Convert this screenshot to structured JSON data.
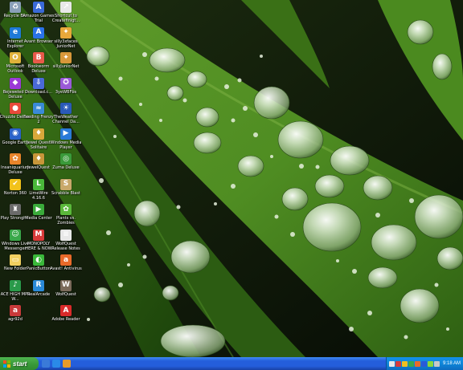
{
  "desktop": {
    "icons": [
      {
        "label": "Recycle Bin",
        "icon": "recycle-bin-icon",
        "color": "#8aa0b8",
        "glyph": "♻"
      },
      {
        "label": "Internet Explorer",
        "icon": "internet-explorer-icon",
        "color": "#1e7ad8",
        "glyph": "e"
      },
      {
        "label": "Microsoft Outlook",
        "icon": "outlook-icon",
        "color": "#e0b23a",
        "glyph": "O"
      },
      {
        "label": "Bejeweled 2 Deluxe",
        "icon": "bejeweled-icon",
        "color": "#9b3bd6",
        "glyph": "◆"
      },
      {
        "label": "Chuzzle Deluxe",
        "icon": "chuzzle-icon",
        "color": "#e84a3a",
        "glyph": "●"
      },
      {
        "label": "Google Earth",
        "icon": "google-earth-icon",
        "color": "#2a62c9",
        "glyph": "◉"
      },
      {
        "label": "Insaniquarium Deluxe",
        "icon": "insaniquarium-icon",
        "color": "#e8842a",
        "glyph": "✿"
      },
      {
        "label": "Norton 360",
        "icon": "norton-icon",
        "color": "#f2c21a",
        "glyph": "✔"
      },
      {
        "label": "Play Strongh...",
        "icon": "stronghold-icon",
        "color": "#6a6a6a",
        "glyph": "♜"
      },
      {
        "label": "Windows Live Messenger",
        "icon": "messenger-icon",
        "color": "#3aa84a",
        "glyph": "☺"
      },
      {
        "label": "New Folder",
        "icon": "folder-icon",
        "color": "#f0d060",
        "glyph": "▭"
      },
      {
        "label": "ACE HIGH MP3 W...",
        "icon": "ace-mp3-icon",
        "color": "#2a9a4a",
        "glyph": "♪"
      },
      {
        "label": "agr92d",
        "icon": "agr92d-icon",
        "color": "#c83a3a",
        "glyph": "a"
      },
      {
        "label": "Amazon Games Trial",
        "icon": "amazon-games-icon",
        "color": "#3a6ad8",
        "glyph": "A"
      },
      {
        "label": "Avant Browser",
        "icon": "avant-browser-icon",
        "color": "#2a72e8",
        "glyph": "A"
      },
      {
        "label": "Bookworm Deluxe",
        "icon": "bookworm-icon",
        "color": "#e85a4a",
        "glyph": "B"
      },
      {
        "label": "Download.c...",
        "icon": "download-icon",
        "color": "#4a6ad8",
        "glyph": "⇩"
      },
      {
        "label": "Feeding Frenzy 2",
        "icon": "feeding-frenzy-icon",
        "color": "#3a8ad8",
        "glyph": "≈"
      },
      {
        "label": "Jewel Quest Solitaire",
        "icon": "jewel-quest-icon",
        "color": "#d8a83a",
        "glyph": "♦"
      },
      {
        "label": "JewelQuest",
        "icon": "jewelquest-icon",
        "color": "#c8963a",
        "glyph": "♦"
      },
      {
        "label": "LimeWire 4.16.6",
        "icon": "limewire-icon",
        "color": "#4ab83a",
        "glyph": "L"
      },
      {
        "label": "Media Center",
        "icon": "media-center-icon",
        "color": "#3aaa3a",
        "glyph": "▶"
      },
      {
        "label": "MONOPOLY HERE & NOW",
        "icon": "monopoly-icon",
        "color": "#d83a3a",
        "glyph": "M"
      },
      {
        "label": "PanicButton",
        "icon": "panic-button-icon",
        "color": "#3ab83a",
        "glyph": "◐"
      },
      {
        "label": "RealArcade",
        "icon": "realarcade-icon",
        "color": "#2a8ad8",
        "glyph": "R"
      },
      {
        "label": "Shortcut to Createfinigt...",
        "icon": "shortcut-icon",
        "color": "#e8e8e8",
        "glyph": "↗"
      },
      {
        "label": "silly3xfaces JuniorNet",
        "icon": "juniornet-icon",
        "color": "#e8a83a",
        "glyph": "✦"
      },
      {
        "label": "sillyJuniorNet",
        "icon": "juniornet-2-icon",
        "color": "#d8983a",
        "glyph": "✦"
      },
      {
        "label": "3yeWBFbs",
        "icon": "app-icon",
        "color": "#9a5ad8",
        "glyph": "✪"
      },
      {
        "label": "TheWeather Channel Da...",
        "icon": "weather-icon",
        "color": "#2a5ab8",
        "glyph": "☀"
      },
      {
        "label": "Windows Media Player",
        "icon": "media-player-icon",
        "color": "#2a7ad8",
        "glyph": "▶"
      },
      {
        "label": "Zuma Deluxe",
        "icon": "zuma-icon",
        "color": "#3a9a3a",
        "glyph": "◎"
      },
      {
        "label": "Scrabble Blast",
        "icon": "scrabble-icon",
        "color": "#c8a86a",
        "glyph": "S"
      },
      {
        "label": "Plants vs. Zombies",
        "icon": "plants-zombies-icon",
        "color": "#5ab83a",
        "glyph": "✿"
      },
      {
        "label": "WolfQuest Release Notes",
        "icon": "wolfquest-notes-icon",
        "color": "#e8e8e8",
        "glyph": "≡"
      },
      {
        "label": "Avast! Antivirus",
        "icon": "avast-icon",
        "color": "#e86a2a",
        "glyph": "a"
      },
      {
        "label": "WolfQuest",
        "icon": "wolfquest-icon",
        "color": "#7a6a5a",
        "glyph": "W"
      },
      {
        "label": "Adobe Reader",
        "icon": "adobe-reader-icon",
        "color": "#d82a2a",
        "glyph": "A"
      }
    ]
  },
  "taskbar": {
    "start_label": "start",
    "quicklaunch": [
      {
        "icon": "show-desktop-icon",
        "color": "#3a7ad8"
      },
      {
        "icon": "internet-explorer-icon",
        "color": "#2a8ae8"
      },
      {
        "icon": "media-player-icon",
        "color": "#e89a2a"
      }
    ],
    "tray_icons": [
      {
        "icon": "volume-icon",
        "color": "#e8e8e8"
      },
      {
        "icon": "network-icon",
        "color": "#d83a3a"
      },
      {
        "icon": "security-icon",
        "color": "#f0c020"
      },
      {
        "icon": "messenger-tray-icon",
        "color": "#3aa84a"
      },
      {
        "icon": "antivirus-tray-icon",
        "color": "#e86a2a"
      },
      {
        "icon": "update-icon",
        "color": "#2a5ad8"
      },
      {
        "icon": "battery-icon",
        "color": "#8ad83a"
      },
      {
        "icon": "display-icon",
        "color": "#c8c8c8"
      }
    ],
    "clock": "9:18 AM"
  }
}
